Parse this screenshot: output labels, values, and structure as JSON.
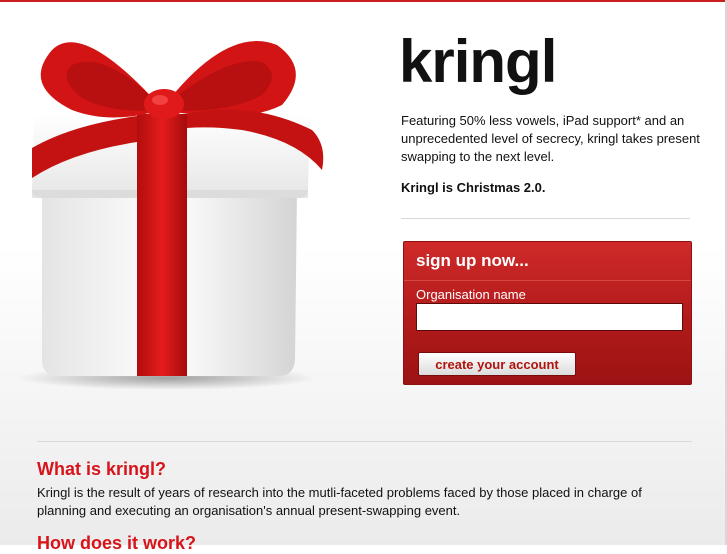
{
  "brand": {
    "logo": "kringl"
  },
  "intro": {
    "tagline": "Featuring 50% less vowels, iPad support* and an unprecedented level of secrecy, kringl takes present swapping to the next level.",
    "slogan": "Kringl is Christmas 2.0."
  },
  "signup": {
    "title": "sign up now...",
    "org_label": "Organisation name",
    "org_value": "",
    "button_label": "create your account"
  },
  "about": {
    "what_title": "What is kringl?",
    "what_body": "Kringl is the result of years of research into the mutli-faceted problems faced by those placed in charge of planning and executing an organisation's annual present-swapping event.",
    "how_title": "How does it work?"
  },
  "colors": {
    "accent": "#d7141b",
    "signup_bg": "#b21a1a",
    "ribbon": "#d21414"
  }
}
